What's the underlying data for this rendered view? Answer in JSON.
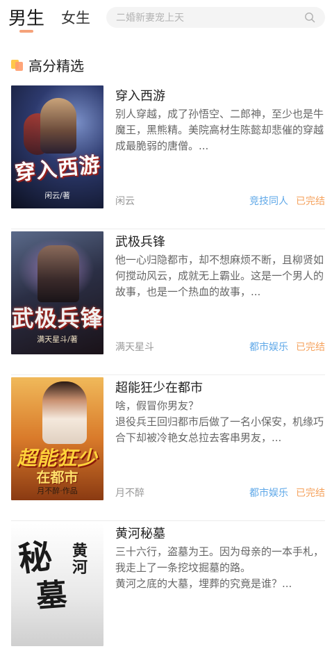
{
  "header": {
    "tab_male": "男生",
    "tab_female": "女生",
    "search_placeholder": "二婚新妻宠上天"
  },
  "section": {
    "title": "高分精选"
  },
  "books": [
    {
      "title": "穿入西游",
      "description": "别人穿越，成了孙悟空、二郎神，至少也是牛魔王，黑熊精。美院高材生陈懿却悲催的穿越成最脆弱的唐僧。...",
      "author": "闲云",
      "category": "竞技同人",
      "status": "已完结",
      "cover_title": "穿入西游",
      "cover_author": "闲云/著"
    },
    {
      "title": "武极兵锋",
      "description": "他一心归隐都市，却不想麻烦不断，且柳贤如何搅动风云，成就无上霸业。这是一个男人的故事，也是一个热血的故事，...",
      "author": "满天星斗",
      "category": "都市娱乐",
      "status": "已完结",
      "cover_title": "武极兵锋",
      "cover_author": "满天星斗/著"
    },
    {
      "title": "超能狂少在都市",
      "description": "啥，假冒你男友？\n退役兵王回归都市后做了一名小保安，机缘巧合下却被冷艳女总拉去客串男友，...",
      "author": "月不醉",
      "category": "都市娱乐",
      "status": "已完结",
      "cover_title": "超能狂少",
      "cover_subtitle": "在都市",
      "cover_author": "月不醉·作品"
    },
    {
      "title": "黄河秘墓",
      "description": "三十六行，盗墓为王。因为母亲的一本手札，我走上了一条挖坟掘墓的路。\n黄河之底的大墓，埋葬的究竟是谁？...",
      "author": "",
      "category": "",
      "status": "",
      "cover_title": "秘",
      "cover_title2": "墓",
      "cover_subtitle": "黄河"
    }
  ],
  "colors": {
    "accent": "#f5a27a",
    "category": "#5fa8e8",
    "status": "#f5a25d"
  }
}
